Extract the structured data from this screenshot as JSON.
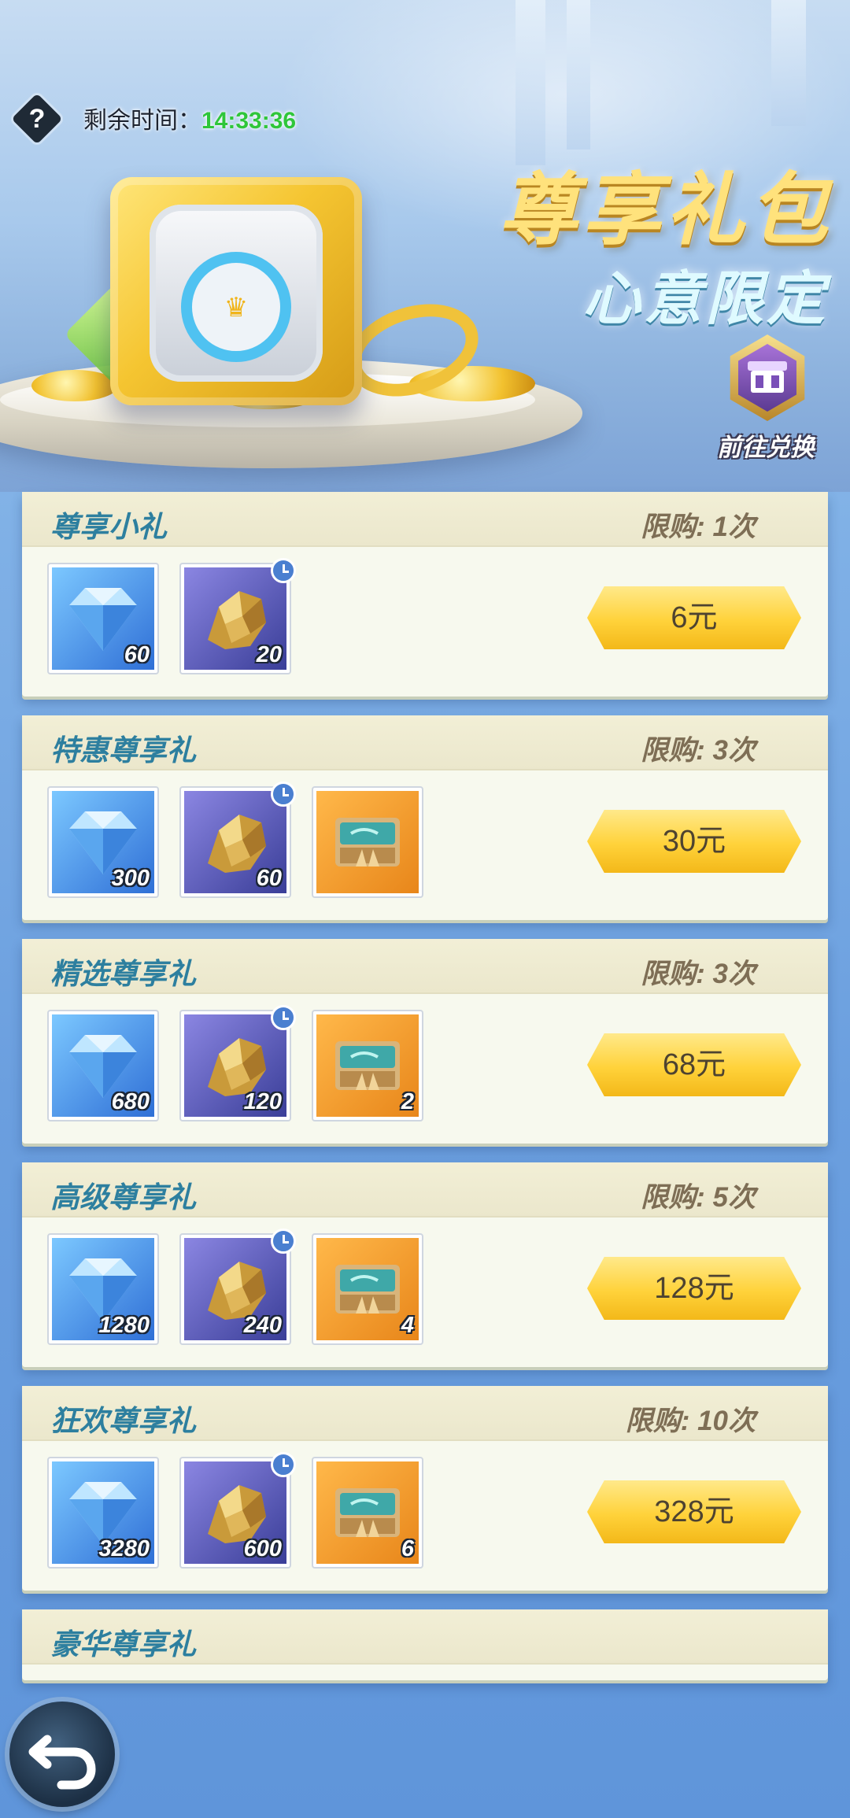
{
  "header": {
    "help_label": "?",
    "timer_label": "剩余时间：",
    "timer_value": "14:33:36",
    "title": "尊享礼包",
    "subtitle": "心意限定",
    "exchange_label": "前往兑换"
  },
  "packs": [
    {
      "title": "尊享小礼",
      "limit": "限购: 1次",
      "price": "6元",
      "items": [
        {
          "type": "diamond",
          "qty": "60"
        },
        {
          "type": "ore",
          "qty": "20",
          "timed": true
        }
      ]
    },
    {
      "title": "特惠尊享礼",
      "limit": "限购: 3次",
      "price": "30元",
      "items": [
        {
          "type": "diamond",
          "qty": "300"
        },
        {
          "type": "ore",
          "qty": "60",
          "timed": true
        },
        {
          "type": "box",
          "qty": ""
        }
      ]
    },
    {
      "title": "精选尊享礼",
      "limit": "限购: 3次",
      "price": "68元",
      "items": [
        {
          "type": "diamond",
          "qty": "680"
        },
        {
          "type": "ore",
          "qty": "120",
          "timed": true
        },
        {
          "type": "box",
          "qty": "2"
        }
      ]
    },
    {
      "title": "高级尊享礼",
      "limit": "限购: 5次",
      "price": "128元",
      "items": [
        {
          "type": "diamond",
          "qty": "1280"
        },
        {
          "type": "ore",
          "qty": "240",
          "timed": true
        },
        {
          "type": "box",
          "qty": "4"
        }
      ]
    },
    {
      "title": "狂欢尊享礼",
      "limit": "限购: 10次",
      "price": "328元",
      "items": [
        {
          "type": "diamond",
          "qty": "3280"
        },
        {
          "type": "ore",
          "qty": "600",
          "timed": true
        },
        {
          "type": "box",
          "qty": "6"
        }
      ]
    }
  ],
  "partial_pack": {
    "title": "豪华尊享礼"
  },
  "icons": {
    "help": "question-icon",
    "exchange": "shop-icon",
    "back": "back-arrow-icon",
    "diamond": "diamond-icon",
    "ore": "gold-ore-icon",
    "box": "treasure-box-icon",
    "clock": "clock-icon"
  },
  "colors": {
    "timer_value": "#2fc63a",
    "title": "#ffe27c",
    "pack_title": "#2d7f9f",
    "price_button": "#ffd23a"
  }
}
